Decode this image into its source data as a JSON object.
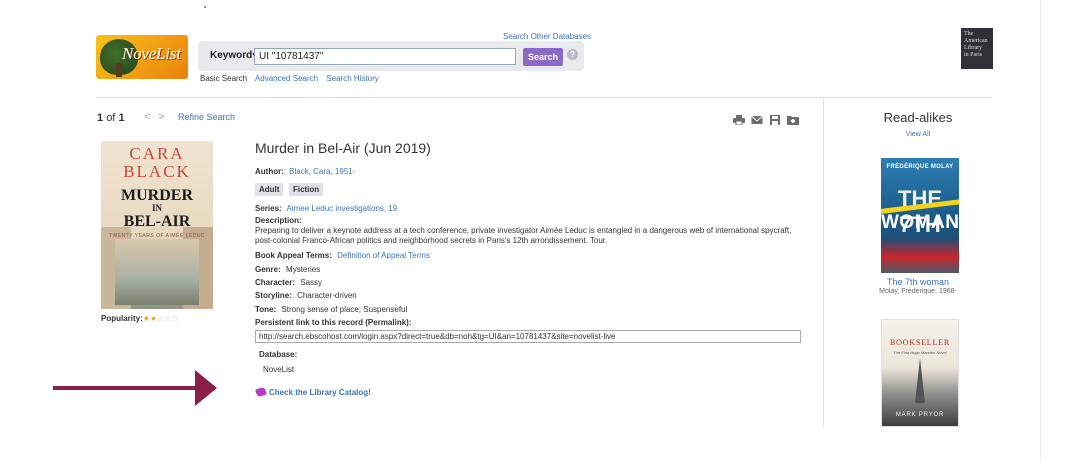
{
  "header": {
    "logo_text": "NoveList",
    "search_other_label": "Search Other Databases",
    "field_label": "Keyword",
    "query": "UI \"10781437\"",
    "search_button": "Search",
    "help_glyph": "?",
    "links": [
      "Basic Search",
      "Advanced Search",
      "Search History"
    ],
    "institution_logo_lines": [
      "The",
      "American",
      "Library",
      "in Paris"
    ]
  },
  "nav": {
    "result_current": "1",
    "result_of": "of",
    "result_total": "1",
    "prev_glyph": "<",
    "next_glyph": ">",
    "refine": "Refine Search"
  },
  "toolbar": {
    "icons": [
      "print-icon",
      "email-icon",
      "save-icon",
      "folder-icon"
    ]
  },
  "cover": {
    "author": "CARA BLACK",
    "title_lines": [
      "MURDER",
      "IN",
      "BEL-AIR"
    ],
    "tagline": "TWENTY YEARS OF AIMÉE LEDUC"
  },
  "popularity": {
    "label": "Popularity:",
    "stars_filled": 2,
    "stars_total": 5
  },
  "record": {
    "title": "Murder in Bel-Air (Jun 2019)",
    "author_label": "Author:",
    "author_value": "Black, Cara, 1951-",
    "badges": [
      "Adult",
      "Fiction"
    ],
    "series_label": "Series:",
    "series_value": "Aimee Leduc investigations, 19",
    "description_label": "Description:",
    "description": "Preparing to deliver a keynote address at a tech conference, private investigator Aimée Leduc is entangled in a dangerous web of international spycraft, post-colonial Franco-African politics and neighborhood secrets in Paris's 12th arrondissement. Tour.",
    "appeal_label": "Book Appeal Terms:",
    "appeal_value": "Definition of Appeal Terms",
    "genre_label": "Genre:",
    "genre_value": "Mysteries",
    "character_label": "Character:",
    "character_value": "Sassy",
    "storyline_label": "Storyline:",
    "storyline_value": "Character-driven",
    "tone_label": "Tone:",
    "tone_value": "Strong sense of place; Suspenseful",
    "permalink_label": "Persistent link to this record (Permalink):",
    "permalink_value": "http://search.ebscohost.com/login.aspx?direct=true&db=noh&tg=UI&an=10781437&site=novelist-live",
    "database_label": "Database:",
    "database_value": "NoveList",
    "catalog_link": "Check the Library Catalog!"
  },
  "readalikes": {
    "title": "Read-alikes",
    "view_all": "View All",
    "items": [
      {
        "title": "The 7th woman",
        "author": "Molay, Frederique, 1968-",
        "cover_author": "FRÉDÉRIQUE MOLAY",
        "cover_title_a": "THE 7TH",
        "cover_title_b": "WOMAN"
      },
      {
        "cover_title": "BOOKSELLER",
        "cover_sub": "The First Hugo Marston Novel",
        "cover_author": "MARK PRYOR"
      }
    ]
  },
  "colors": {
    "link": "#3d72b8",
    "search_button": "#8c69c7",
    "annotation_arrow": "#8b1f45",
    "star_filled": "#f0a21b",
    "star_empty": "#c9c9c9",
    "catalog_icon": "#b83ec4"
  }
}
